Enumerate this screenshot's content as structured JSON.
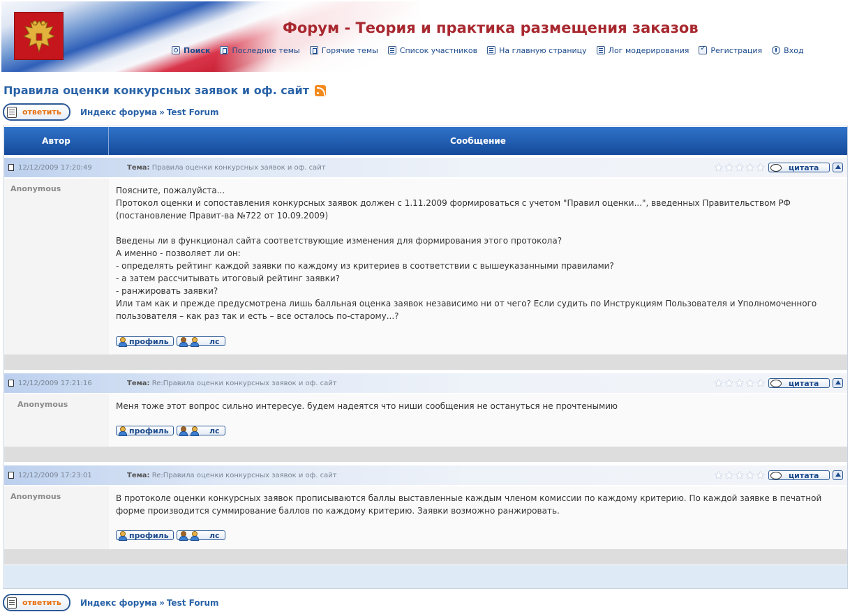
{
  "forum": {
    "title": "Форум - Теория и практика размещения заказов"
  },
  "nav": [
    {
      "label": "Поиск",
      "icon": "search-icon"
    },
    {
      "label": "Последние темы",
      "icon": "document-icon"
    },
    {
      "label": "Горячие темы",
      "icon": "document-icon"
    },
    {
      "label": "Список участников",
      "icon": "list-icon"
    },
    {
      "label": "На главную страницу",
      "icon": "list-icon"
    },
    {
      "label": "Лог модерирования",
      "icon": "list-icon"
    },
    {
      "label": "Регистрация",
      "icon": "checkbox-icon"
    },
    {
      "label": "Вход",
      "icon": "power-icon"
    }
  ],
  "topic": {
    "title": "Правила оценки конкурсных заявок и оф. сайт"
  },
  "actions": {
    "reply_label": "ответить",
    "breadcrumb_index": "Индекс форума",
    "breadcrumb_separator": "»",
    "breadcrumb_forum": "Test Forum"
  },
  "table": {
    "col_author": "Автор",
    "col_message": "Сообщение"
  },
  "labels": {
    "subject_prefix": "Тема:",
    "quote": "цитата",
    "profile": "профиль",
    "pm": "лс"
  },
  "posts": [
    {
      "date": "12/12/2009 17:20:49",
      "subject": "Правила оценки конкурсных заявок и оф. сайт",
      "author": "Anonymous",
      "text": "Поясните, пожалуйста...\nПротокол оценки и сопоставления конкурсных заявок должен с 1.11.2009 формироваться с учетом \"Правил оценки...\", введенных Правительством РФ (постановление Правит-ва №722 от 10.09.2009)\n\nВведены ли в функционал сайта соответствующие изменения для формирования этого протокола?\nА именно - позволяет ли он:\n- определять рейтинг каждой заявки по каждому из критериев в соответствии с вышеуказанными правилами?\n- а затем рассчитывать итоговый рейтинг заявки?\n- ранжировать заявки?\nИли там как и прежде предусмотрена лишь балльная оценка заявок независимо ни от чего? Если судить по Инструкциям Пользователя и Уполномоченного пользователя – как раз так и есть – все осталось по-старому...?"
    },
    {
      "date": "12/12/2009 17:21:16",
      "subject": "Re:Правила оценки конкурсных заявок и оф. сайт",
      "author": "Anonymous",
      "text": "Меня тоже этот вопрос сильно интересуе. будем надеятся что ниши сообщения не остануться не прочтенымию"
    },
    {
      "date": "12/12/2009 17:23:01",
      "subject": "Re:Правила оценки конкурсных заявок и оф. сайт",
      "author": "Anonymous",
      "text": "В протоколе оценки конкурсных заявок прописываются баллы выставленные каждым членом комиссии по каждому критерию. По каждой заявке в печатной форме производится суммирование баллов по каждому критерию. Заявки возможно ранжировать."
    }
  ],
  "colors": {
    "title_red": "#a8282f",
    "link_blue": "#2a63a8",
    "header_blue": "#154a9a",
    "reply_orange": "#e8700f"
  }
}
